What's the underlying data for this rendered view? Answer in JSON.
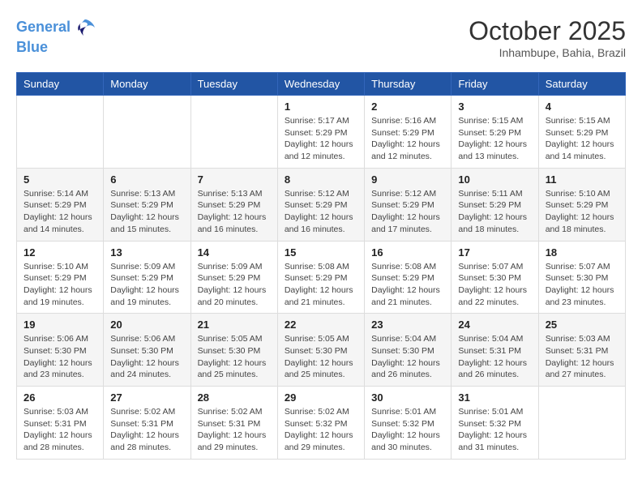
{
  "header": {
    "logo_line1": "General",
    "logo_line2": "Blue",
    "month_title": "October 2025",
    "location": "Inhambupe, Bahia, Brazil"
  },
  "days_of_week": [
    "Sunday",
    "Monday",
    "Tuesday",
    "Wednesday",
    "Thursday",
    "Friday",
    "Saturday"
  ],
  "weeks": [
    [
      {
        "day": "",
        "info": ""
      },
      {
        "day": "",
        "info": ""
      },
      {
        "day": "",
        "info": ""
      },
      {
        "day": "1",
        "info": "Sunrise: 5:17 AM\nSunset: 5:29 PM\nDaylight: 12 hours\nand 12 minutes."
      },
      {
        "day": "2",
        "info": "Sunrise: 5:16 AM\nSunset: 5:29 PM\nDaylight: 12 hours\nand 12 minutes."
      },
      {
        "day": "3",
        "info": "Sunrise: 5:15 AM\nSunset: 5:29 PM\nDaylight: 12 hours\nand 13 minutes."
      },
      {
        "day": "4",
        "info": "Sunrise: 5:15 AM\nSunset: 5:29 PM\nDaylight: 12 hours\nand 14 minutes."
      }
    ],
    [
      {
        "day": "5",
        "info": "Sunrise: 5:14 AM\nSunset: 5:29 PM\nDaylight: 12 hours\nand 14 minutes."
      },
      {
        "day": "6",
        "info": "Sunrise: 5:13 AM\nSunset: 5:29 PM\nDaylight: 12 hours\nand 15 minutes."
      },
      {
        "day": "7",
        "info": "Sunrise: 5:13 AM\nSunset: 5:29 PM\nDaylight: 12 hours\nand 16 minutes."
      },
      {
        "day": "8",
        "info": "Sunrise: 5:12 AM\nSunset: 5:29 PM\nDaylight: 12 hours\nand 16 minutes."
      },
      {
        "day": "9",
        "info": "Sunrise: 5:12 AM\nSunset: 5:29 PM\nDaylight: 12 hours\nand 17 minutes."
      },
      {
        "day": "10",
        "info": "Sunrise: 5:11 AM\nSunset: 5:29 PM\nDaylight: 12 hours\nand 18 minutes."
      },
      {
        "day": "11",
        "info": "Sunrise: 5:10 AM\nSunset: 5:29 PM\nDaylight: 12 hours\nand 18 minutes."
      }
    ],
    [
      {
        "day": "12",
        "info": "Sunrise: 5:10 AM\nSunset: 5:29 PM\nDaylight: 12 hours\nand 19 minutes."
      },
      {
        "day": "13",
        "info": "Sunrise: 5:09 AM\nSunset: 5:29 PM\nDaylight: 12 hours\nand 19 minutes."
      },
      {
        "day": "14",
        "info": "Sunrise: 5:09 AM\nSunset: 5:29 PM\nDaylight: 12 hours\nand 20 minutes."
      },
      {
        "day": "15",
        "info": "Sunrise: 5:08 AM\nSunset: 5:29 PM\nDaylight: 12 hours\nand 21 minutes."
      },
      {
        "day": "16",
        "info": "Sunrise: 5:08 AM\nSunset: 5:29 PM\nDaylight: 12 hours\nand 21 minutes."
      },
      {
        "day": "17",
        "info": "Sunrise: 5:07 AM\nSunset: 5:30 PM\nDaylight: 12 hours\nand 22 minutes."
      },
      {
        "day": "18",
        "info": "Sunrise: 5:07 AM\nSunset: 5:30 PM\nDaylight: 12 hours\nand 23 minutes."
      }
    ],
    [
      {
        "day": "19",
        "info": "Sunrise: 5:06 AM\nSunset: 5:30 PM\nDaylight: 12 hours\nand 23 minutes."
      },
      {
        "day": "20",
        "info": "Sunrise: 5:06 AM\nSunset: 5:30 PM\nDaylight: 12 hours\nand 24 minutes."
      },
      {
        "day": "21",
        "info": "Sunrise: 5:05 AM\nSunset: 5:30 PM\nDaylight: 12 hours\nand 25 minutes."
      },
      {
        "day": "22",
        "info": "Sunrise: 5:05 AM\nSunset: 5:30 PM\nDaylight: 12 hours\nand 25 minutes."
      },
      {
        "day": "23",
        "info": "Sunrise: 5:04 AM\nSunset: 5:30 PM\nDaylight: 12 hours\nand 26 minutes."
      },
      {
        "day": "24",
        "info": "Sunrise: 5:04 AM\nSunset: 5:31 PM\nDaylight: 12 hours\nand 26 minutes."
      },
      {
        "day": "25",
        "info": "Sunrise: 5:03 AM\nSunset: 5:31 PM\nDaylight: 12 hours\nand 27 minutes."
      }
    ],
    [
      {
        "day": "26",
        "info": "Sunrise: 5:03 AM\nSunset: 5:31 PM\nDaylight: 12 hours\nand 28 minutes."
      },
      {
        "day": "27",
        "info": "Sunrise: 5:02 AM\nSunset: 5:31 PM\nDaylight: 12 hours\nand 28 minutes."
      },
      {
        "day": "28",
        "info": "Sunrise: 5:02 AM\nSunset: 5:31 PM\nDaylight: 12 hours\nand 29 minutes."
      },
      {
        "day": "29",
        "info": "Sunrise: 5:02 AM\nSunset: 5:32 PM\nDaylight: 12 hours\nand 29 minutes."
      },
      {
        "day": "30",
        "info": "Sunrise: 5:01 AM\nSunset: 5:32 PM\nDaylight: 12 hours\nand 30 minutes."
      },
      {
        "day": "31",
        "info": "Sunrise: 5:01 AM\nSunset: 5:32 PM\nDaylight: 12 hours\nand 31 minutes."
      },
      {
        "day": "",
        "info": ""
      }
    ]
  ]
}
